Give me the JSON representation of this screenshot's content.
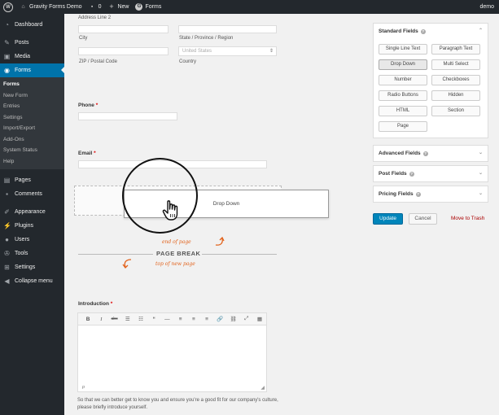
{
  "adminbar": {
    "site_name": "Gravity Forms Demo",
    "comments_count": "0",
    "new_label": "New",
    "forms_label": "Forms",
    "user": "demo"
  },
  "sidebar": {
    "dashboard": "Dashboard",
    "posts": "Posts",
    "media": "Media",
    "forms": "Forms",
    "submenu": [
      "Forms",
      "New Form",
      "Entries",
      "Settings",
      "Import/Export",
      "Add-Ons",
      "System Status",
      "Help"
    ],
    "pages": "Pages",
    "comments": "Comments",
    "appearance": "Appearance",
    "plugins": "Plugins",
    "users": "Users",
    "tools": "Tools",
    "settings": "Settings",
    "collapse": "Collapse menu"
  },
  "form": {
    "address_line2_label": "Address Line 2",
    "city_label": "City",
    "state_label": "State / Province / Region",
    "zip_label": "ZIP / Postal Code",
    "country_value": "United States",
    "country_label": "Country",
    "phone_label": "Phone",
    "email_label": "Email",
    "required_mark": "*",
    "drag_ghost_label": "Drop Down",
    "page_break": {
      "title": "PAGE BREAK",
      "end_note": "end of page",
      "top_note": "top of new page"
    },
    "introduction_label": "Introduction",
    "editor_toolbar": [
      "B",
      "I",
      "abc",
      "☰",
      "☷",
      "“",
      "—",
      "≡",
      "≡",
      "≡",
      "🔗",
      "⛓",
      "⤢",
      "▦"
    ],
    "editor_path": "p",
    "description": "So that we can better get to know you and ensure you're a good fit for our company's culture, please briefly introduce yourself."
  },
  "panels": {
    "standard_title": "Standard Fields",
    "standard_buttons": [
      "Single Line Text",
      "Paragraph Text",
      "Drop Down",
      "Multi Select",
      "Number",
      "Checkboxes",
      "Radio Buttons",
      "Hidden",
      "HTML",
      "Section",
      "Page"
    ],
    "advanced_title": "Advanced Fields",
    "post_title": "Post Fields",
    "pricing_title": "Pricing Fields"
  },
  "actions": {
    "update": "Update",
    "cancel": "Cancel",
    "trash": "Move to Trash"
  },
  "colors": {
    "sidebar_bg": "#23282d",
    "active_blue": "#0073aa",
    "update_blue": "#0085ba",
    "annotation_orange": "#e2621b",
    "trash_red": "#aa0000"
  }
}
